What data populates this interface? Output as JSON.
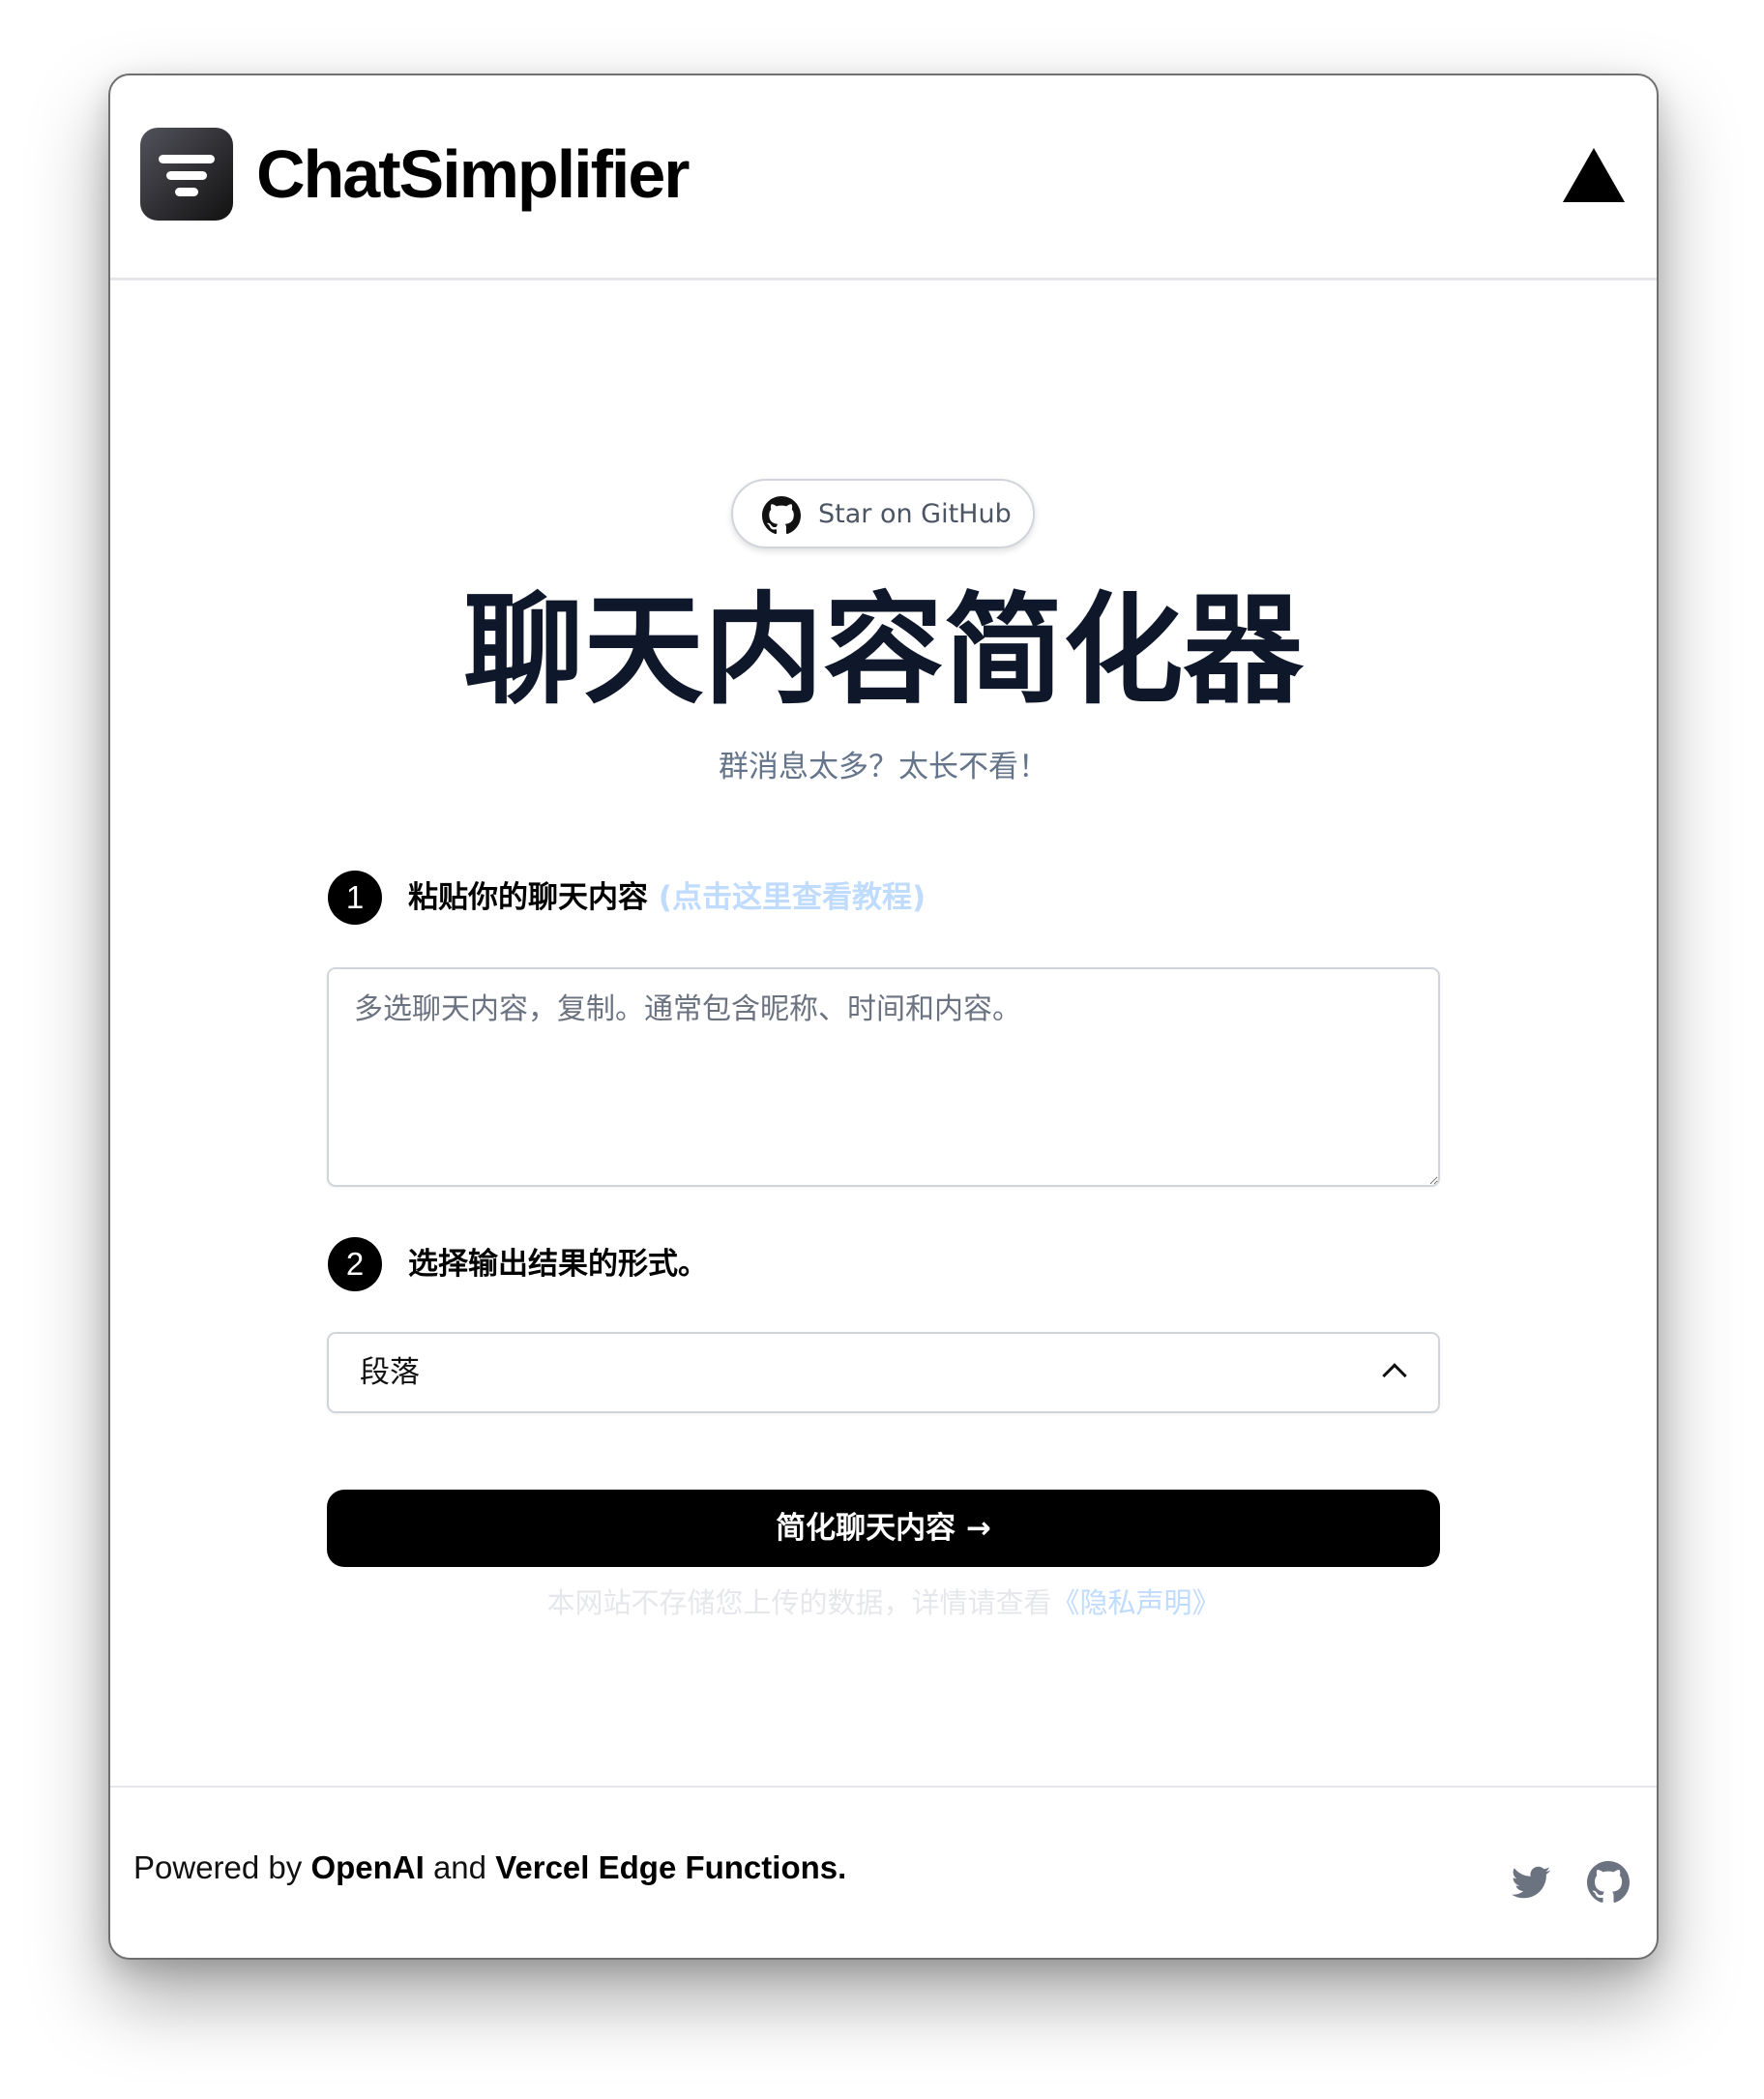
{
  "header": {
    "brand": "ChatSimplifier"
  },
  "hero": {
    "github_label": "Star on GitHub",
    "title": "聊天内容简化器",
    "subtitle": "群消息太多？太长不看！"
  },
  "step1": {
    "number": "1",
    "label": "粘贴你的聊天内容",
    "link": "(点击这里查看教程)"
  },
  "chat_input": {
    "value": "",
    "placeholder": "多选聊天内容，复制。通常包含昵称、时间和内容。"
  },
  "step2": {
    "number": "2",
    "label": "选择输出结果的形式。"
  },
  "format_select": {
    "selected": "段落"
  },
  "submit": {
    "label": "简化聊天内容 →"
  },
  "privacy": {
    "text": "本网站不存储您上传的数据，详情请查看",
    "link": "《隐私声明》"
  },
  "footer": {
    "powered_by": "Powered by",
    "openai": "OpenAI",
    "and": "and",
    "vercel": "Vercel Edge Functions."
  },
  "colors": {
    "primary": "#000000",
    "title": "#0f172a",
    "subtitle": "#64748b",
    "link": "#bfdbfe",
    "border": "#d1d5db"
  },
  "icons": {
    "logo": "filter-lines-logo",
    "header_right": "vercel-triangle-icon",
    "pill": "github-icon",
    "footer": [
      "twitter-icon",
      "github-icon"
    ]
  }
}
